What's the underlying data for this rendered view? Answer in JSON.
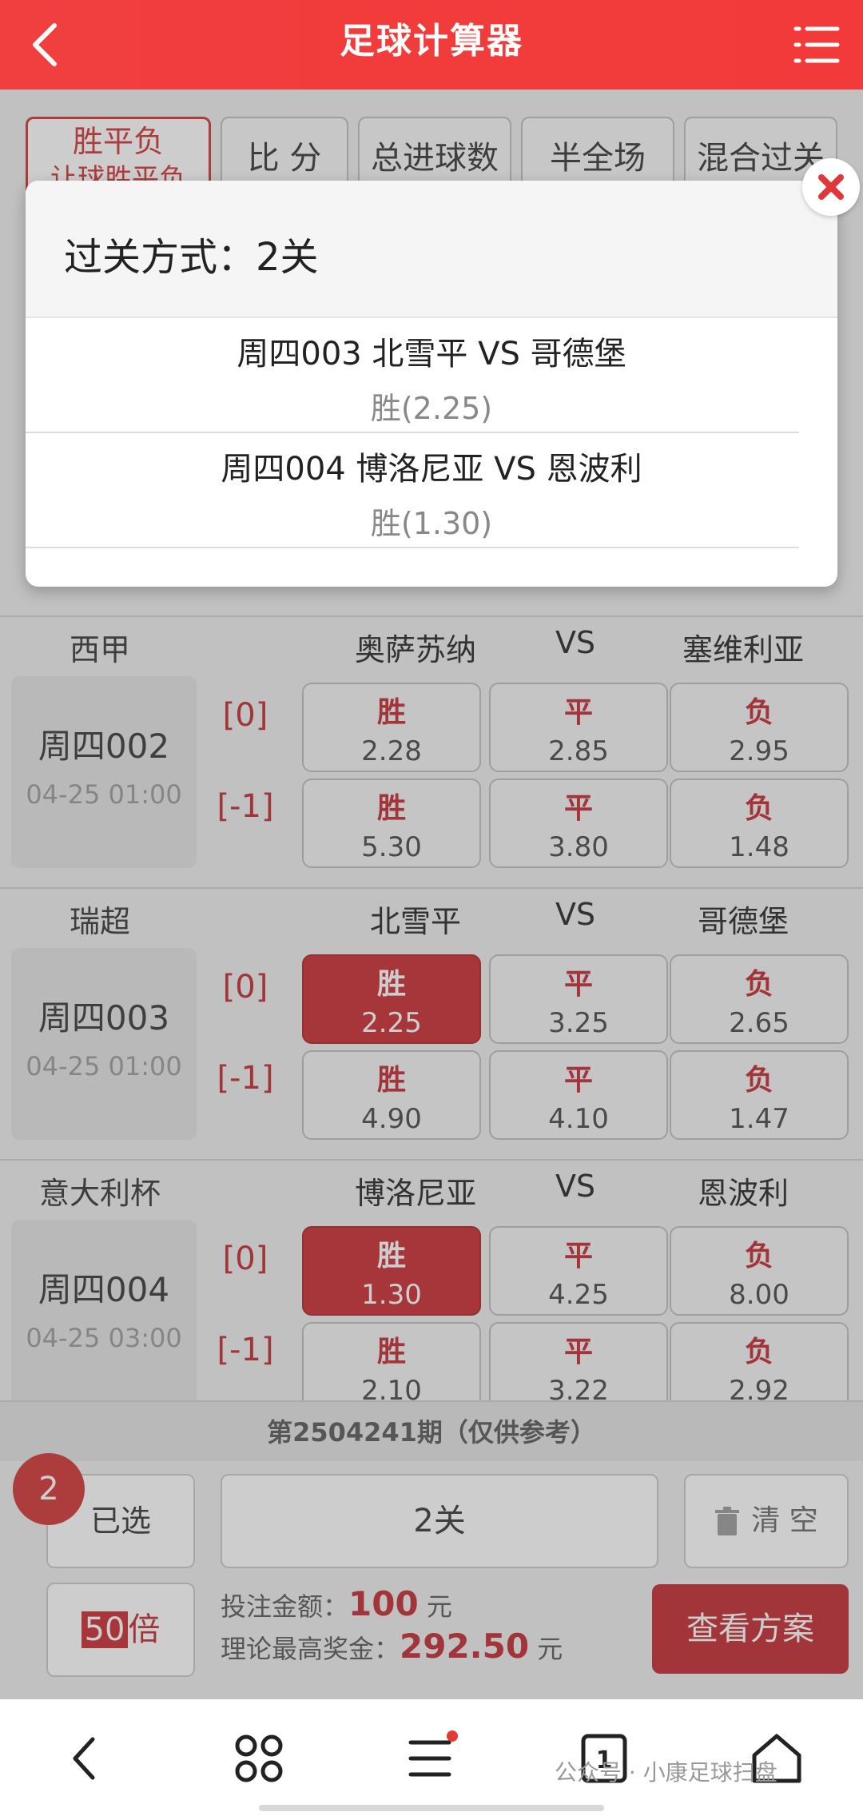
{
  "header": {
    "title": "足球计算器"
  },
  "tabs": [
    {
      "label": "胜平负",
      "sub": "让球胜平负",
      "active": true
    },
    {
      "label": "比 分"
    },
    {
      "label": "总进球数"
    },
    {
      "label": "半全场"
    },
    {
      "label": "混合过关"
    }
  ],
  "matches": [
    {
      "league": "西甲",
      "home": "奥萨苏纳",
      "vs": "VS",
      "away": "塞维利亚",
      "code": "周四002",
      "time": "04-25 01:00",
      "rows": [
        {
          "hcap": "[0]",
          "cells": [
            {
              "label": "胜",
              "odd": "2.28"
            },
            {
              "label": "平",
              "odd": "2.85"
            },
            {
              "label": "负",
              "odd": "2.95"
            }
          ]
        },
        {
          "hcap": "[-1]",
          "cells": [
            {
              "label": "胜",
              "odd": "5.30"
            },
            {
              "label": "平",
              "odd": "3.80"
            },
            {
              "label": "负",
              "odd": "1.48"
            }
          ]
        }
      ]
    },
    {
      "league": "瑞超",
      "home": "北雪平",
      "vs": "VS",
      "away": "哥德堡",
      "code": "周四003",
      "time": "04-25 01:00",
      "rows": [
        {
          "hcap": "[0]",
          "cells": [
            {
              "label": "胜",
              "odd": "2.25",
              "selected": true
            },
            {
              "label": "平",
              "odd": "3.25"
            },
            {
              "label": "负",
              "odd": "2.65"
            }
          ]
        },
        {
          "hcap": "[-1]",
          "cells": [
            {
              "label": "胜",
              "odd": "4.90"
            },
            {
              "label": "平",
              "odd": "4.10"
            },
            {
              "label": "负",
              "odd": "1.47"
            }
          ]
        }
      ]
    },
    {
      "league": "意大利杯",
      "home": "博洛尼亚",
      "vs": "VS",
      "away": "恩波利",
      "code": "周四004",
      "time": "04-25 03:00",
      "rows": [
        {
          "hcap": "[0]",
          "cells": [
            {
              "label": "胜",
              "odd": "1.30",
              "selected": true
            },
            {
              "label": "平",
              "odd": "4.25"
            },
            {
              "label": "负",
              "odd": "8.00"
            }
          ]
        },
        {
          "hcap": "[-1]",
          "cells": [
            {
              "label": "胜",
              "odd": "2.10"
            },
            {
              "label": "平",
              "odd": "3.22"
            },
            {
              "label": "负",
              "odd": "2.92"
            }
          ]
        }
      ]
    }
  ],
  "period": "第2504241期（仅供参考）",
  "bottom": {
    "badge": "2",
    "selected_label": "已选",
    "pass_label": "2关",
    "clear_label": "清 空",
    "multiplier_num": "50",
    "multiplier_unit": "倍",
    "bet_label": "投注金额：",
    "bet_amount": "100",
    "bet_unit": "元",
    "max_label": "理论最高奖金：",
    "max_amount": "292.50",
    "max_unit": "元",
    "view_button": "查看方案"
  },
  "modal": {
    "title": "过关方式：2关",
    "items": [
      {
        "teams": "周四003 北雪平 VS 哥德堡",
        "pick": "胜(2.25)"
      },
      {
        "teams": "周四004 博洛尼亚 VS 恩波利",
        "pick": "胜(1.30)"
      }
    ]
  },
  "watermark": "公众号 · 小康足球扫盘",
  "colors": {
    "accent": "#f13e3e",
    "selected": "#c8282c"
  }
}
